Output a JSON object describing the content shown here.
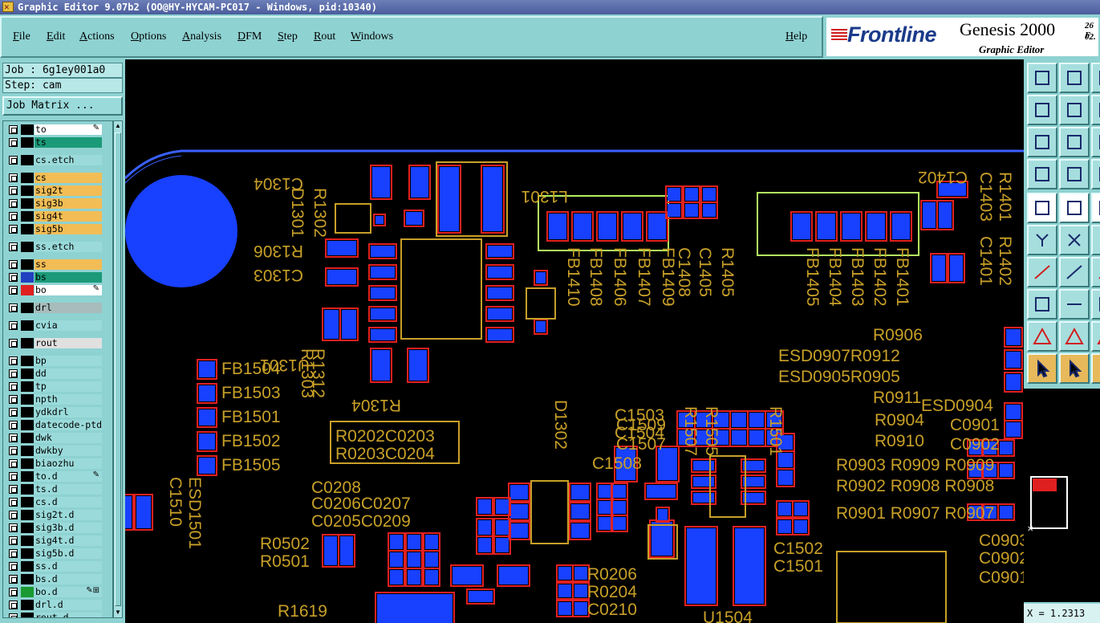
{
  "window": {
    "title": "Graphic Editor 9.07b2 (OO@HY-HYCAM-PC017 - Windows, pid:10340)"
  },
  "menu": {
    "file": "File",
    "edit": "Edit",
    "actions": "Actions",
    "options": "Options",
    "analysis": "Analysis",
    "dfm": "DFM",
    "step": "Step",
    "rout": "Rout",
    "windows": "Windows",
    "help": "Help"
  },
  "brand": {
    "logo": "Frontline",
    "product": "Genesis 2000",
    "subtitle": "Graphic Editor",
    "date_top": "26 F",
    "date_bottom": "02."
  },
  "job_info": {
    "job": "Job : 6g1ey001a0",
    "step": "Step: cam",
    "matrix_button": "Job Matrix ..."
  },
  "layers": [
    {
      "name": "to",
      "color": "#ffffff",
      "swatch": "#000000",
      "mark": "✎"
    },
    {
      "name": "ts",
      "color": "#1a9a78",
      "swatch": "#000000",
      "mark": ""
    },
    {
      "name": "cs.etch",
      "color": "#9adada",
      "swatch": "#000000",
      "mark": ""
    },
    {
      "name": "cs",
      "color": "#f3bd55",
      "swatch": "#000000",
      "mark": ""
    },
    {
      "name": "sig2t",
      "color": "#f3bd55",
      "swatch": "#000000",
      "mark": ""
    },
    {
      "name": "sig3b",
      "color": "#f3bd55",
      "swatch": "#000000",
      "mark": ""
    },
    {
      "name": "sig4t",
      "color": "#f3bd55",
      "swatch": "#000000",
      "mark": ""
    },
    {
      "name": "sig5b",
      "color": "#f3bd55",
      "swatch": "#000000",
      "mark": ""
    },
    {
      "name": "ss.etch",
      "color": "#9adada",
      "swatch": "#000000",
      "mark": ""
    },
    {
      "name": "ss",
      "color": "#f3bd55",
      "swatch": "#000000",
      "mark": ""
    },
    {
      "name": "bs",
      "color": "#1a9a78",
      "swatch": "#2040c0",
      "mark": ""
    },
    {
      "name": "bo",
      "color": "#ffffff",
      "swatch": "#e02020",
      "mark": "✎"
    },
    {
      "name": "drl",
      "color": "#a8bcbc",
      "swatch": "#000000",
      "mark": ""
    },
    {
      "name": "cvia",
      "color": "#9adada",
      "swatch": "#000000",
      "mark": ""
    },
    {
      "name": "rout",
      "color": "#e0e0e0",
      "swatch": "#000000",
      "mark": ""
    },
    {
      "name": "bp",
      "color": "#9adada",
      "swatch": "#000000",
      "mark": ""
    },
    {
      "name": "dd",
      "color": "#9adada",
      "swatch": "#000000",
      "mark": ""
    },
    {
      "name": "tp",
      "color": "#9adada",
      "swatch": "#000000",
      "mark": ""
    },
    {
      "name": "npth",
      "color": "#9adada",
      "swatch": "#000000",
      "mark": ""
    },
    {
      "name": "ydkdrl",
      "color": "#9adada",
      "swatch": "#000000",
      "mark": ""
    },
    {
      "name": "datecode-ptd",
      "color": "#9adada",
      "swatch": "#000000",
      "mark": ""
    },
    {
      "name": "dwk",
      "color": "#9adada",
      "swatch": "#000000",
      "mark": ""
    },
    {
      "name": "dwkby",
      "color": "#9adada",
      "swatch": "#000000",
      "mark": ""
    },
    {
      "name": "biaozhu",
      "color": "#9adada",
      "swatch": "#000000",
      "mark": ""
    },
    {
      "name": "to.d",
      "color": "#9adada",
      "swatch": "#000000",
      "mark": "✎"
    },
    {
      "name": "ts.d",
      "color": "#9adada",
      "swatch": "#000000",
      "mark": ""
    },
    {
      "name": "cs.d",
      "color": "#9adada",
      "swatch": "#000000",
      "mark": ""
    },
    {
      "name": "sig2t.d",
      "color": "#9adada",
      "swatch": "#000000",
      "mark": ""
    },
    {
      "name": "sig3b.d",
      "color": "#9adada",
      "swatch": "#000000",
      "mark": ""
    },
    {
      "name": "sig4t.d",
      "color": "#9adada",
      "swatch": "#000000",
      "mark": ""
    },
    {
      "name": "sig5b.d",
      "color": "#9adada",
      "swatch": "#000000",
      "mark": ""
    },
    {
      "name": "ss.d",
      "color": "#9adada",
      "swatch": "#000000",
      "mark": ""
    },
    {
      "name": "bs.d",
      "color": "#9adada",
      "swatch": "#000000",
      "mark": ""
    },
    {
      "name": "bo.d",
      "color": "#9adada",
      "swatch": "#1a9a30",
      "mark": "✎⊞"
    },
    {
      "name": "drl.d",
      "color": "#9adada",
      "swatch": "#000000",
      "mark": ""
    },
    {
      "name": "rout.d",
      "color": "#9adada",
      "swatch": "#000000",
      "mark": ""
    }
  ],
  "silkscreen": {
    "c1304": "C1304",
    "l1301": "L1301",
    "c1402": "C1402",
    "d1301": "D1301",
    "r1302": "R1302",
    "r1306": "R1306",
    "c1303": "C1303",
    "r1312": "R1312",
    "r1303": "R1303",
    "u1301": "U1301",
    "d1302": "D1302",
    "r1304": "R1304",
    "fb1410": "FB1410",
    "fb1408": "FB1408",
    "fb1406": "FB1406",
    "fb1407": "FB1407",
    "fb1409": "FB1409",
    "c1408": "C1408",
    "c1405": "C1405",
    "r1405": "R1405",
    "fb1405": "FB1405",
    "fb1404": "FB1404",
    "fb1403": "FB1403",
    "fb1402": "FB1402",
    "fb1401": "FB1401",
    "c1401": "C1401",
    "r1402": "R1402",
    "c1403": "C1403",
    "r1401": "R1401",
    "fb1504": "FB1504",
    "fb1503": "FB1503",
    "fb1501": "FB1501",
    "fb1502": "FB1502",
    "fb1505": "FB1505",
    "r0202": "R0202C0203",
    "r0203": "R0203C0204",
    "c0208": "C0208",
    "c0206": "C0206C0207",
    "c0205": "C0205C0209",
    "r0502": "R0502",
    "r0501": "R0501",
    "c1510": "C1510",
    "esd1501": "ESD1501",
    "c1509": "C1509",
    "c1507": "C1507",
    "c1508": "C1508",
    "c1503": "C1503",
    "c1504": "C1504",
    "r1507": "R1507",
    "r1505": "R1505",
    "r1501": "R1501",
    "c1502": "C1502",
    "c1501": "C1501",
    "r0206": "R0206",
    "r0204": "R0204",
    "c0210": "C0210",
    "r1619": "R1619",
    "u1504": "U1504",
    "r0906": "R0906",
    "r0912": "ESD0907R0912",
    "r0905": "ESD0905R0905",
    "r0911": "R0911",
    "esd0904": "ESD0904",
    "r0904": "R0904",
    "c0901": "C0901",
    "r0910": "R0910",
    "c0902": "C0902",
    "r0903": "R0903 R0909 R0909",
    "r0902": "R0902 R0908 R0908",
    "r0901": "R0901 R0907 R0907",
    "c0903": "C0903",
    "c0902b": "C0902",
    "c0901b": "C0901"
  },
  "readout": {
    "x": "X = 1.2313"
  },
  "colors": {
    "pad_blue": "#1840ff",
    "pad_outline": "#e02020",
    "silk_gold": "#c8a028",
    "highlight_green": "#b4f060",
    "board_edge": "#3a60ff"
  }
}
